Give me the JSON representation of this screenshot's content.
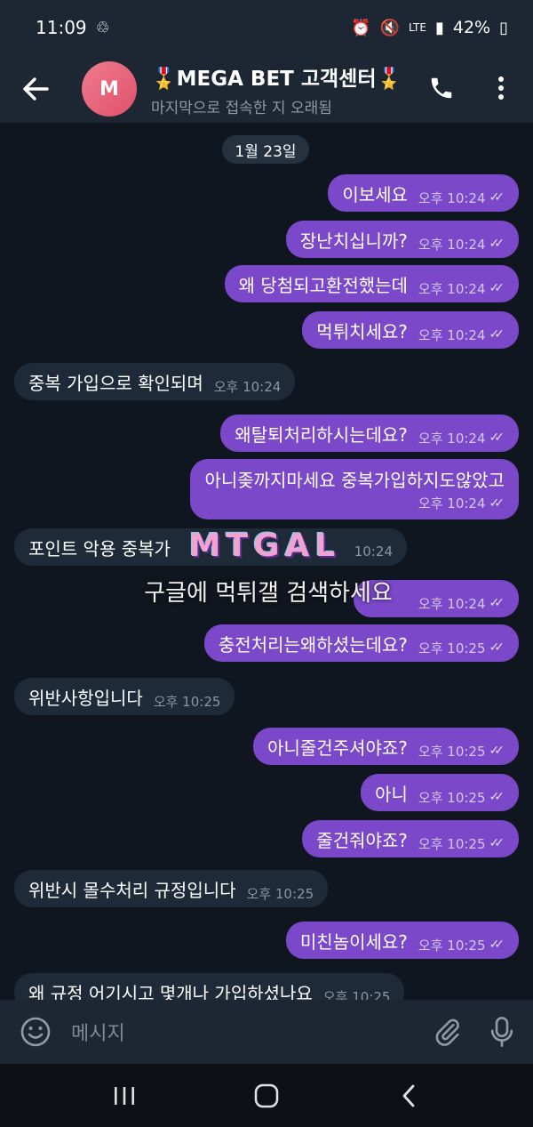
{
  "status_bar": {
    "time": "11:09",
    "battery": "42%",
    "network": "LTE"
  },
  "header": {
    "back_icon": "arrow-left-icon",
    "avatar_initial": "M",
    "title": "🎖️MEGA BET 고객센터🎖️",
    "status": "마지막으로 접속한 지 오래됨",
    "call_icon": "phone-icon",
    "menu_icon": "more-vert-icon"
  },
  "chat": {
    "date": "1월 23일",
    "messages": [
      {
        "dir": "out",
        "text": "이보세요",
        "time": "오후 10:24"
      },
      {
        "dir": "out",
        "text": "장난치십니까?",
        "time": "오후 10:24"
      },
      {
        "dir": "out",
        "text": "왜 당첨되고환전했는데",
        "time": "오후 10:24"
      },
      {
        "dir": "out",
        "text": "먹튀치세요?",
        "time": "오후 10:24"
      },
      {
        "dir": "in",
        "text": "중복 가입으로 확인되며",
        "time": "오후 10:24"
      },
      {
        "dir": "out",
        "text": "왜탈퇴처리하시는데요?",
        "time": "오후 10:24"
      },
      {
        "dir": "out",
        "text": "아니좆까지마세요 중복가입하지도않았고",
        "time": "오후 10:24"
      },
      {
        "dir": "in",
        "text": "포인트 악용 중복가",
        "time": "10:24"
      },
      {
        "dir": "out",
        "text": "",
        "time": "오후 10:24"
      },
      {
        "dir": "out",
        "text": "충전처리는왜하셨는데요?",
        "time": "오후 10:25"
      },
      {
        "dir": "in",
        "text": "위반사항입니다",
        "time": "오후 10:25"
      },
      {
        "dir": "out",
        "text": "아니줄건주셔야죠?",
        "time": "오후 10:25"
      },
      {
        "dir": "out",
        "text": "아니",
        "time": "오후 10:25"
      },
      {
        "dir": "out",
        "text": "줄건줘야죠?",
        "time": "오후 10:25"
      },
      {
        "dir": "in",
        "text": "위반시 몰수처리 규정입니다",
        "time": "오후 10:25"
      },
      {
        "dir": "out",
        "text": "미친놈이세요?",
        "time": "오후 10:25"
      },
      {
        "dir": "in",
        "text": "왜 규정 어기시고 몇개나 가입하셨나요",
        "time": "오후 10:25"
      }
    ]
  },
  "watermark": {
    "logo": "MTGAL",
    "text": "구글에 먹튀갤 검색하세요"
  },
  "composer": {
    "placeholder": "메시지",
    "emoji_icon": "emoji-icon",
    "attach_icon": "paperclip-icon",
    "mic_icon": "microphone-icon"
  },
  "colors": {
    "outgoing_bubble": "#7a48c9",
    "incoming_bubble": "#1e2a37",
    "header_bg": "#1c2733",
    "chat_bg": "#10161f"
  }
}
